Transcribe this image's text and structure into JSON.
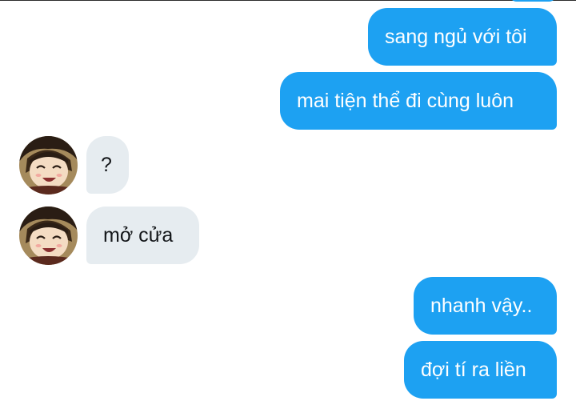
{
  "conversation": {
    "messages": [
      {
        "direction": "outgoing",
        "text": "sang ngủ với tôi"
      },
      {
        "direction": "outgoing",
        "text": "mai tiện thể đi cùng luôn"
      },
      {
        "direction": "incoming",
        "text": "?"
      },
      {
        "direction": "incoming",
        "text": "mở cửa"
      },
      {
        "direction": "outgoing",
        "text": "nhanh vậy.."
      },
      {
        "direction": "outgoing",
        "text": "đợi tí ra liền"
      }
    ]
  },
  "colors": {
    "outgoing_bubble": "#1da1f2",
    "incoming_bubble": "#e6ecf0",
    "outgoing_text": "#ffffff",
    "incoming_text": "#14171a"
  },
  "icons": {
    "contact_avatar": "anime-character-avatar"
  }
}
